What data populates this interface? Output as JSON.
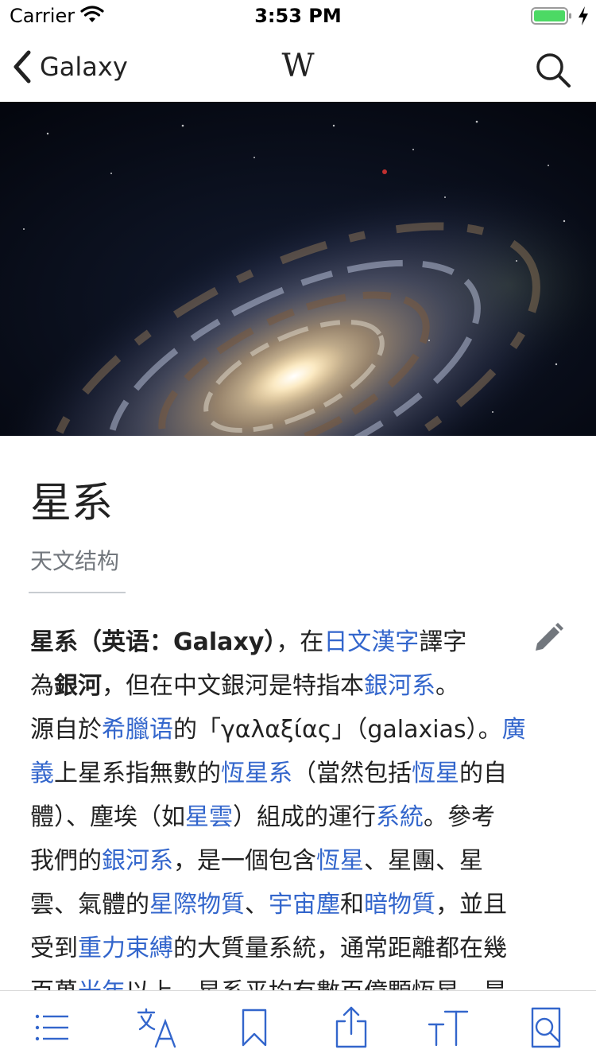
{
  "status_bar": {
    "carrier": "Carrier",
    "time": "3:53 PM",
    "battery_color": "#4cd964"
  },
  "nav": {
    "back_label": "Galaxy",
    "logo_text": "W",
    "icons": {
      "back": "chevron-left-icon",
      "search": "search-icon"
    }
  },
  "article": {
    "title": "星系",
    "subtitle": "天文结构",
    "link_color": "#3366cc",
    "paragraph": [
      [
        {
          "t": "星系（英语：Galaxy）",
          "b": true
        },
        {
          "t": "，在"
        },
        {
          "t": "日文漢字",
          "l": true
        },
        {
          "t": "譯字"
        }
      ],
      [
        {
          "t": "為"
        },
        {
          "t": "銀河",
          "b": true
        },
        {
          "t": "，但在中文銀河是特指本"
        },
        {
          "t": "銀河系",
          "l": true
        },
        {
          "t": "。"
        }
      ],
      [
        {
          "t": "源自於"
        },
        {
          "t": "希臘语",
          "l": true
        },
        {
          "t": "的「γαλαξίας」（galaxias）。"
        },
        {
          "t": "廣",
          "l": true
        }
      ],
      [
        {
          "t": "義",
          "l": true
        },
        {
          "t": "上星系指無數的"
        },
        {
          "t": "恆星系",
          "l": true
        },
        {
          "t": "（當然包括"
        },
        {
          "t": "恆星",
          "l": true
        },
        {
          "t": "的自"
        }
      ],
      [
        {
          "t": "體）、塵埃（如"
        },
        {
          "t": "星雲",
          "l": true
        },
        {
          "t": "）組成的運行"
        },
        {
          "t": "系統",
          "l": true
        },
        {
          "t": "。參考"
        }
      ],
      [
        {
          "t": "我們的"
        },
        {
          "t": "銀河系",
          "l": true
        },
        {
          "t": "，是一個包含"
        },
        {
          "t": "恆星",
          "l": true
        },
        {
          "t": "、星團、星"
        }
      ],
      [
        {
          "t": "雲、氣體的"
        },
        {
          "t": "星際物質",
          "l": true
        },
        {
          "t": "、"
        },
        {
          "t": "宇宙塵",
          "l": true
        },
        {
          "t": "和"
        },
        {
          "t": "暗物質",
          "l": true
        },
        {
          "t": "，並且"
        }
      ],
      [
        {
          "t": "受到"
        },
        {
          "t": "重力束縛",
          "l": true
        },
        {
          "t": "的大質量系統，通常距離都在幾"
        }
      ],
      [
        {
          "t": "百萬"
        },
        {
          "t": "光年",
          "l": true
        },
        {
          "t": "以上。星系平均有數百億顆恆星，是"
        }
      ]
    ]
  },
  "toolbar": {
    "accent_color": "#3366cc",
    "icons": [
      "table-of-contents-icon",
      "languages-icon",
      "bookmark-icon",
      "share-icon",
      "text-size-icon",
      "find-in-page-icon"
    ]
  }
}
